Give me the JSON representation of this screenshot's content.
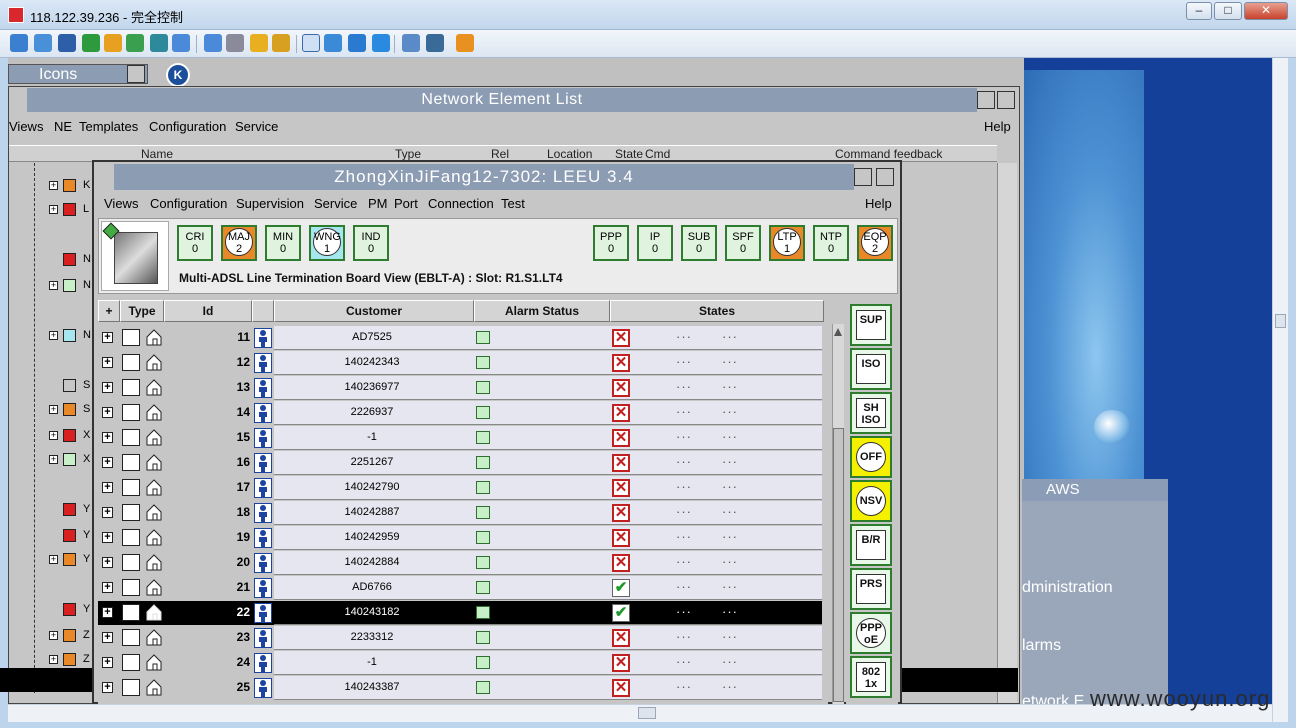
{
  "window": {
    "title": "118.122.39.236 - 完全控制",
    "watermark": "www.wooyun.org"
  },
  "icons_window": {
    "title": "Icons",
    "badge": "K"
  },
  "nel": {
    "title": "Network Element List",
    "menu": [
      "Views",
      "NE",
      "Templates",
      "Configuration",
      "Service"
    ],
    "help": "Help",
    "columns": [
      "Name",
      "Type",
      "Rel",
      "Location",
      "State",
      "Cmd",
      "Command feedback"
    ],
    "tree_labels": [
      "K",
      "L",
      "N",
      "N",
      "N",
      "S",
      "S",
      "X",
      "X",
      "Y",
      "Y",
      "Y",
      "Y",
      "Z",
      "Z"
    ]
  },
  "aws": {
    "title": "AWS",
    "items": [
      "dministration",
      "larms",
      "etwork E"
    ]
  },
  "leeu": {
    "title": "ZhongXinJiFang12-7302: LEEU 3.4",
    "menu": [
      "Views",
      "Configuration",
      "Supervision",
      "Service",
      "PM",
      "Port",
      "Connection",
      "Test"
    ],
    "help": "Help",
    "alarms_left": [
      {
        "label": "CRI",
        "count": "0",
        "color": "green"
      },
      {
        "label": "MAJ",
        "count": "2",
        "color": "orange"
      },
      {
        "label": "MIN",
        "count": "0",
        "color": "green"
      },
      {
        "label": "WNG",
        "count": "1",
        "color": "cyan"
      },
      {
        "label": "IND",
        "count": "0",
        "color": "green"
      }
    ],
    "alarms_right": [
      {
        "label": "PPP",
        "count": "0",
        "color": "green"
      },
      {
        "label": "IP",
        "count": "0",
        "color": "green"
      },
      {
        "label": "SUB",
        "count": "0",
        "color": "green"
      },
      {
        "label": "SPF",
        "count": "0",
        "color": "green"
      },
      {
        "label": "LTP",
        "count": "1",
        "color": "orange"
      },
      {
        "label": "NTP",
        "count": "0",
        "color": "green"
      },
      {
        "label": "EQP",
        "count": "2",
        "color": "orange"
      }
    ],
    "board_title": "Multi-ADSL Line Termination Board View (EBLT-A) : Slot: R1.S1.LT4",
    "table": {
      "headers": [
        "Type",
        "Id",
        "Customer",
        "Alarm Status",
        "States"
      ],
      "rows": [
        {
          "id": "11",
          "customer": "AD7525",
          "state": "x"
        },
        {
          "id": "12",
          "customer": "140242343",
          "state": "x"
        },
        {
          "id": "13",
          "customer": "140236977",
          "state": "x"
        },
        {
          "id": "14",
          "customer": "2226937",
          "state": "x"
        },
        {
          "id": "15",
          "customer": "-1",
          "state": "x"
        },
        {
          "id": "16",
          "customer": "2251267",
          "state": "x"
        },
        {
          "id": "17",
          "customer": "140242790",
          "state": "x"
        },
        {
          "id": "18",
          "customer": "140242887",
          "state": "x"
        },
        {
          "id": "19",
          "customer": "140242959",
          "state": "x"
        },
        {
          "id": "20",
          "customer": "140242884",
          "state": "x"
        },
        {
          "id": "21",
          "customer": "AD6766",
          "state": "ok"
        },
        {
          "id": "22",
          "customer": "140243182",
          "state": "ok",
          "selected": true
        },
        {
          "id": "23",
          "customer": "2233312",
          "state": "x"
        },
        {
          "id": "24",
          "customer": "-1",
          "state": "x"
        },
        {
          "id": "25",
          "customer": "140243387",
          "state": "x"
        }
      ]
    },
    "side_buttons": [
      {
        "label": "SUP",
        "style": "green"
      },
      {
        "label": "ISO",
        "style": "green"
      },
      {
        "label": "SH ISO",
        "style": "green"
      },
      {
        "label": "OFF",
        "style": "yellow"
      },
      {
        "label": "NSV",
        "style": "yellow"
      },
      {
        "label": "B/R",
        "style": "green"
      },
      {
        "label": "PRS",
        "style": "green"
      },
      {
        "label": "PPP oE",
        "style": "green"
      },
      {
        "label": "802 1x",
        "style": "green"
      }
    ]
  }
}
